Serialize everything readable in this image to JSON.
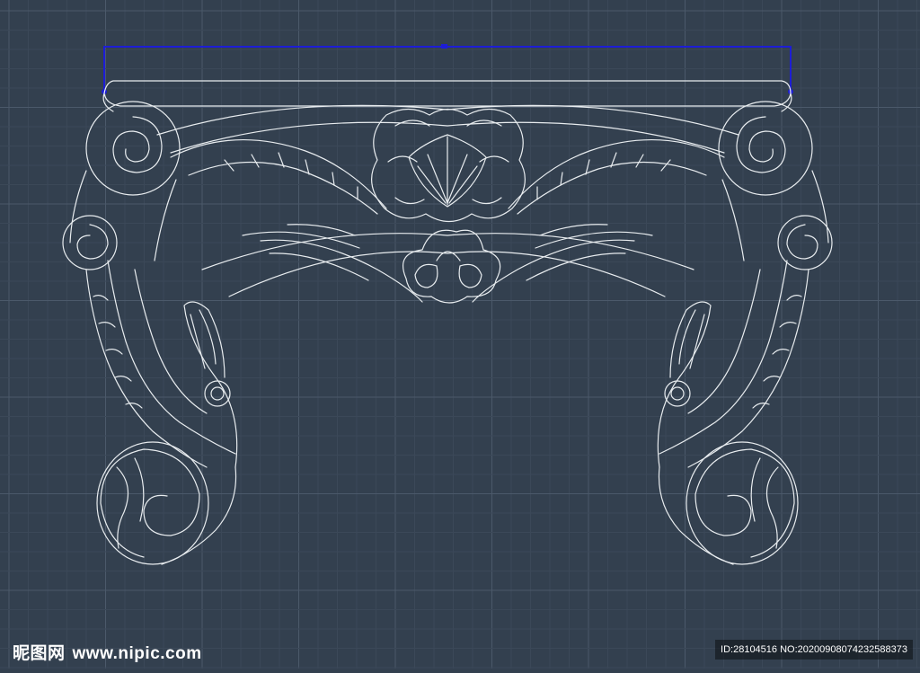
{
  "watermark": {
    "brand": "昵图网",
    "site": "www.nipic.com",
    "id_line": "ID:28104516 NO:20200908074232588373"
  },
  "colors": {
    "background": "#33404f",
    "grid_minor": "#3b4858",
    "grid_major": "#4b596a",
    "drawing_line": "#e8ecef",
    "selection": "#1d1dd6",
    "grip": "#1d1dd6"
  }
}
